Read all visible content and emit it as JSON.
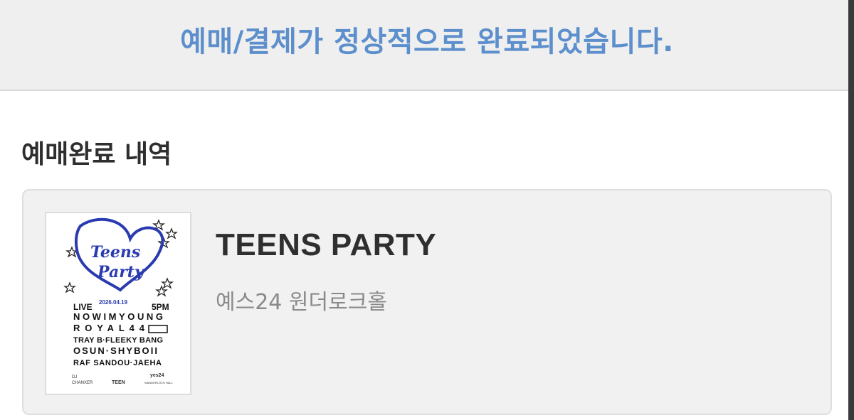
{
  "banner": {
    "message": "예매/결제가 정상적으로 완료되었습니다."
  },
  "section": {
    "title": "예매완료 내역"
  },
  "booking": {
    "title": "TEENS PARTY",
    "venue": "예스24 원더로크홀",
    "poster": {
      "logo_line1": "Teens",
      "logo_line2": "Party",
      "live": "LIVE",
      "date": "2026.04.19",
      "time": "5PM",
      "lineup": [
        "NOWIMYOUNG",
        "ROYAL44",
        "TRAY B·FLEEKY BANG",
        "OSUN·SHYBOII",
        "RAF SANDOU·JAEHA"
      ],
      "dj_label": "DJ",
      "dj_name": "CHANXER",
      "brand_center": "TEEN",
      "brand_right": "yes24",
      "brand_right_sub": "WANDERLOCH HALL",
      "colors": {
        "logo": "#2a3bb0",
        "text": "#111111"
      }
    }
  }
}
